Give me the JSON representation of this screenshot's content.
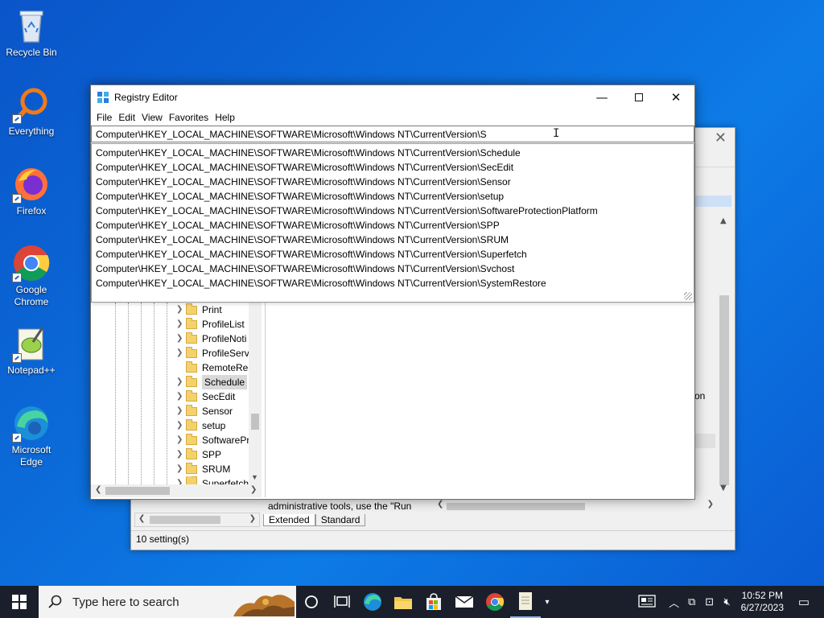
{
  "desktop": {
    "icons": [
      {
        "label": "Recycle Bin"
      },
      {
        "label": "Everything"
      },
      {
        "label": "Firefox"
      },
      {
        "label": "Google Chrome"
      },
      {
        "label": "Notepad++"
      },
      {
        "label": "Microsoft Edge"
      }
    ]
  },
  "back_window": {
    "status": "10 setting(s)",
    "text_fragment": "administrative tools, use the \"Run",
    "tabs": [
      "Extended",
      "Standard"
    ],
    "partial_text": "on"
  },
  "registry": {
    "title": "Registry Editor",
    "menu": [
      "File",
      "Edit",
      "View",
      "Favorites",
      "Help"
    ],
    "address": "Computer\\HKEY_LOCAL_MACHINE\\SOFTWARE\\Microsoft\\Windows NT\\CurrentVersion\\S",
    "suggestions": [
      "Computer\\HKEY_LOCAL_MACHINE\\SOFTWARE\\Microsoft\\Windows NT\\CurrentVersion\\Schedule",
      "Computer\\HKEY_LOCAL_MACHINE\\SOFTWARE\\Microsoft\\Windows NT\\CurrentVersion\\SecEdit",
      "Computer\\HKEY_LOCAL_MACHINE\\SOFTWARE\\Microsoft\\Windows NT\\CurrentVersion\\Sensor",
      "Computer\\HKEY_LOCAL_MACHINE\\SOFTWARE\\Microsoft\\Windows NT\\CurrentVersion\\setup",
      "Computer\\HKEY_LOCAL_MACHINE\\SOFTWARE\\Microsoft\\Windows NT\\CurrentVersion\\SoftwareProtectionPlatform",
      "Computer\\HKEY_LOCAL_MACHINE\\SOFTWARE\\Microsoft\\Windows NT\\CurrentVersion\\SPP",
      "Computer\\HKEY_LOCAL_MACHINE\\SOFTWARE\\Microsoft\\Windows NT\\CurrentVersion\\SRUM",
      "Computer\\HKEY_LOCAL_MACHINE\\SOFTWARE\\Microsoft\\Windows NT\\CurrentVersion\\Superfetch",
      "Computer\\HKEY_LOCAL_MACHINE\\SOFTWARE\\Microsoft\\Windows NT\\CurrentVersion\\Svchost",
      "Computer\\HKEY_LOCAL_MACHINE\\SOFTWARE\\Microsoft\\Windows NT\\CurrentVersion\\SystemRestore"
    ],
    "tree": [
      "Print",
      "ProfileList",
      "ProfileNoti",
      "ProfileServ",
      "RemoteReg",
      "Schedule",
      "SecEdit",
      "Sensor",
      "setup",
      "SoftwarePr",
      "SPP",
      "SRUM",
      "Superfetch"
    ],
    "selected": "Schedule"
  },
  "taskbar": {
    "search_placeholder": "Type here to search",
    "time": "10:52 PM",
    "date": "6/27/2023"
  },
  "colors": {
    "desktop": "#0b6ad8",
    "taskbar": "#1a1f2b",
    "accent": "#0078d4"
  }
}
